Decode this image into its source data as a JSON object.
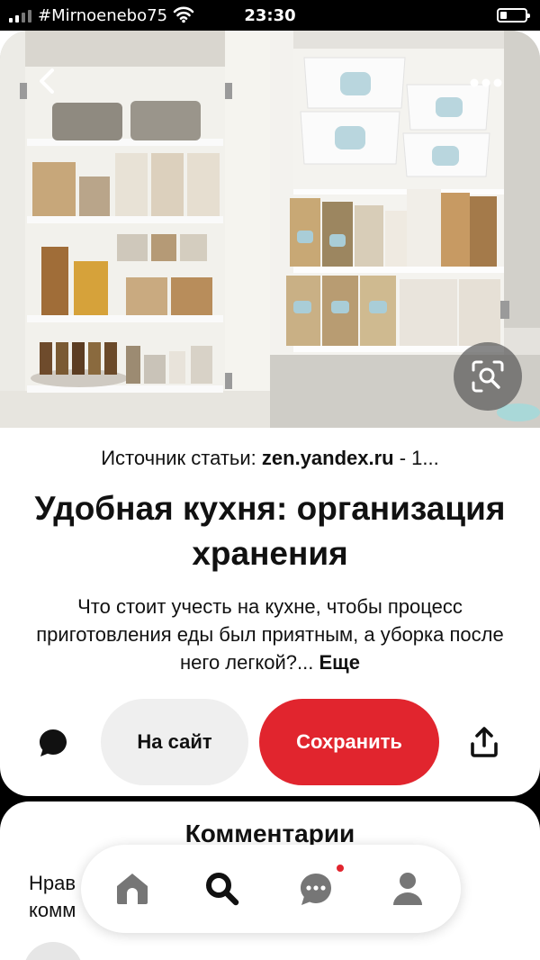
{
  "status_bar": {
    "carrier": "#Mirnoenebo75",
    "time": "23:30",
    "icons": [
      "signal-icon",
      "wifi-icon",
      "battery-icon"
    ]
  },
  "pin": {
    "image_description_icons": [
      "back-icon",
      "more-icon",
      "visual-search-icon"
    ],
    "source_label": "Источник статьи: ",
    "source_domain": "zen.yandex.ru",
    "source_suffix": " - 1...",
    "title": "Удобная кухня: организация хранения",
    "description": "Что стоит учесть на кухне, чтобы процесс приготовления еды был приятным, а уборка после него легкой?...",
    "description_more": "Еще"
  },
  "actions": {
    "visit_label": "На сайт",
    "save_label": "Сохранить"
  },
  "comments": {
    "title": "Комментарии",
    "prompt": "Нрав\nкомм"
  },
  "colors": {
    "accent_red": "#e1252e",
    "button_gray": "#efefef",
    "text": "#111111"
  }
}
